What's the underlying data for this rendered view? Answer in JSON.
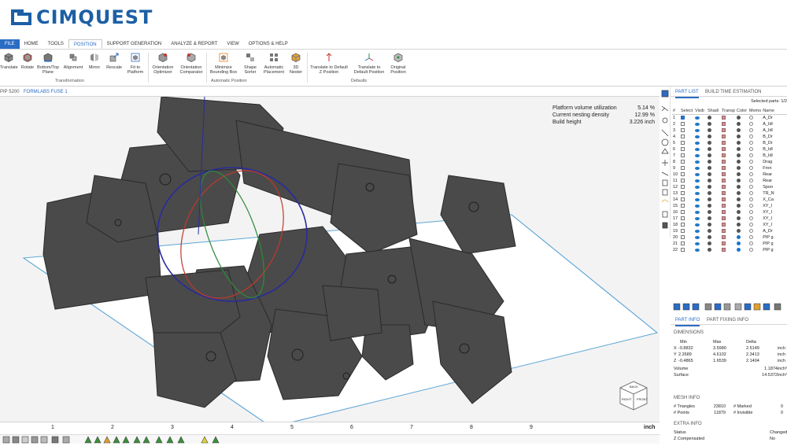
{
  "brand": {
    "name": "CIMQUEST"
  },
  "menu": {
    "tabs": [
      "FILE",
      "HOME",
      "TOOLS",
      "POSITION",
      "SUPPORT GENERATION",
      "ANALYZE & REPORT",
      "VIEW",
      "OPTIONS & HELP"
    ]
  },
  "ribbon": {
    "transform_buttons": [
      "Translate",
      "Rotate",
      "Bottom/Top Plane",
      "Alignment",
      "Mirror",
      "Rescale",
      "Fit to Platform"
    ],
    "transform_label": "Transformation",
    "orient_buttons": [
      "Orientation Optimizer",
      "Orientation Comparator"
    ],
    "auto_buttons": [
      "Minimize Bounding Box",
      "Shape Sorter",
      "Automatic Placement",
      "3D Nester"
    ],
    "auto_label": "Automatic Position",
    "default_buttons": [
      "Translate to Default Z Position",
      "Translate to Default Position",
      "Original Position"
    ],
    "default_label": "Defaults"
  },
  "doc_tabs": [
    "PIP 5200",
    "FORMLABS FUSE 1"
  ],
  "stats": {
    "rows": [
      {
        "label": "Platform volume utilization",
        "value": "5.14 %"
      },
      {
        "label": "Current nesting density",
        "value": "12.99 %"
      },
      {
        "label": "Build height",
        "value": "3.226 inch"
      }
    ]
  },
  "ruler": {
    "ticks": [
      "1",
      "2",
      "3",
      "4",
      "5",
      "6",
      "7",
      "8",
      "9"
    ],
    "unit": "inch"
  },
  "view_cube": {
    "faces": [
      "RIGHT",
      "BACK",
      "FRONT"
    ]
  },
  "panel": {
    "tabs": [
      "PART LIST",
      "BUILD TIME ESTIMATION"
    ],
    "selected_parts": "Selected parts: 1/2",
    "columns": [
      "#",
      "Select",
      "Visib",
      "Shadi",
      "Transp",
      "Color",
      "Memo",
      "Name"
    ],
    "parts": [
      {
        "n": "1",
        "name": "A_Dr"
      },
      {
        "n": "2",
        "name": "A_Idl"
      },
      {
        "n": "3",
        "name": "A_Idl"
      },
      {
        "n": "4",
        "name": "B_Dr"
      },
      {
        "n": "5",
        "name": "B_Dr"
      },
      {
        "n": "6",
        "name": "B_Idl"
      },
      {
        "n": "7",
        "name": "B_Idl"
      },
      {
        "n": "8",
        "name": "Drag"
      },
      {
        "n": "9",
        "name": "Fron"
      },
      {
        "n": "10",
        "name": "Rear"
      },
      {
        "n": "11",
        "name": "Rear"
      },
      {
        "n": "12",
        "name": "Spoo"
      },
      {
        "n": "13",
        "name": "TR_N"
      },
      {
        "n": "14",
        "name": "X_Ca"
      },
      {
        "n": "15",
        "name": "XY_I"
      },
      {
        "n": "16",
        "name": "XY_I"
      },
      {
        "n": "17",
        "name": "XY_I"
      },
      {
        "n": "18",
        "name": "XY_I"
      },
      {
        "n": "19",
        "name": "A_Dr"
      },
      {
        "n": "20",
        "name": "PIP g"
      },
      {
        "n": "21",
        "name": "PIP g"
      },
      {
        "n": "22",
        "name": "PIP g"
      }
    ],
    "info_tabs": [
      "PART INFO",
      "PART FIXING INFO"
    ],
    "dimensions": {
      "title": "DIMENSIONS",
      "headers": [
        "Min",
        "Max",
        "Delta"
      ],
      "rows": [
        {
          "axis": "X",
          "min": "-0.8832",
          "max": "3.5980",
          "delta": "2.5149",
          "unit": "inch"
        },
        {
          "axis": "Y",
          "min": "2.2689",
          "max": "4.6102",
          "delta": "2.3413",
          "unit": "inch"
        },
        {
          "axis": "Z",
          "min": "-0.4865",
          "max": "1.6539",
          "delta": "2.1404",
          "unit": "inch"
        }
      ],
      "volume_label": "Volume",
      "volume": "1.1874",
      "volume_unit": "inch³",
      "surface_label": "Surface",
      "surface": "14.5372",
      "surface_unit": "inch²"
    },
    "mesh": {
      "title": "MESH INFO",
      "triangles_label": "# Triangles",
      "triangles": "23810",
      "points_label": "# Points",
      "points": "11879",
      "marked_label": "# Marked",
      "marked": "0",
      "invisible_label": "# Invisible",
      "invisible": "0"
    },
    "extra": {
      "title": "EXTRA INFO",
      "status_label": "Status",
      "status": "Changed",
      "zcomp_label": "Z Compensated",
      "zcomp": "No"
    }
  }
}
